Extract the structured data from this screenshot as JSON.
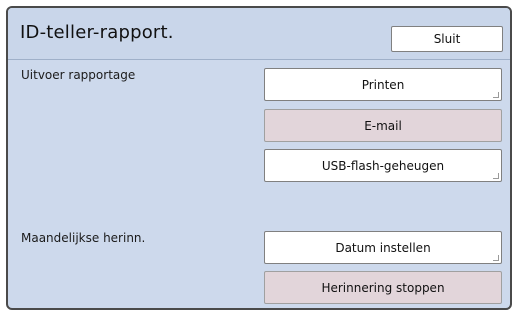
{
  "window": {
    "title": "ID-teller-rapport."
  },
  "header": {
    "close_label": "Sluit"
  },
  "sections": {
    "output": {
      "label": "Uitvoer rapportage",
      "buttons": {
        "print": "Printen",
        "email": "E-mail",
        "usb": "USB-flash-geheugen"
      }
    },
    "monthly": {
      "label": "Maandelijkse herinn.",
      "buttons": {
        "set_date": "Datum instellen",
        "stop_reminder": "Herinnering stoppen"
      }
    }
  },
  "colors": {
    "panel_bg": "#cdd9ec",
    "disabled_button_bg": "#e2d5da",
    "button_bg": "#ffffff"
  }
}
